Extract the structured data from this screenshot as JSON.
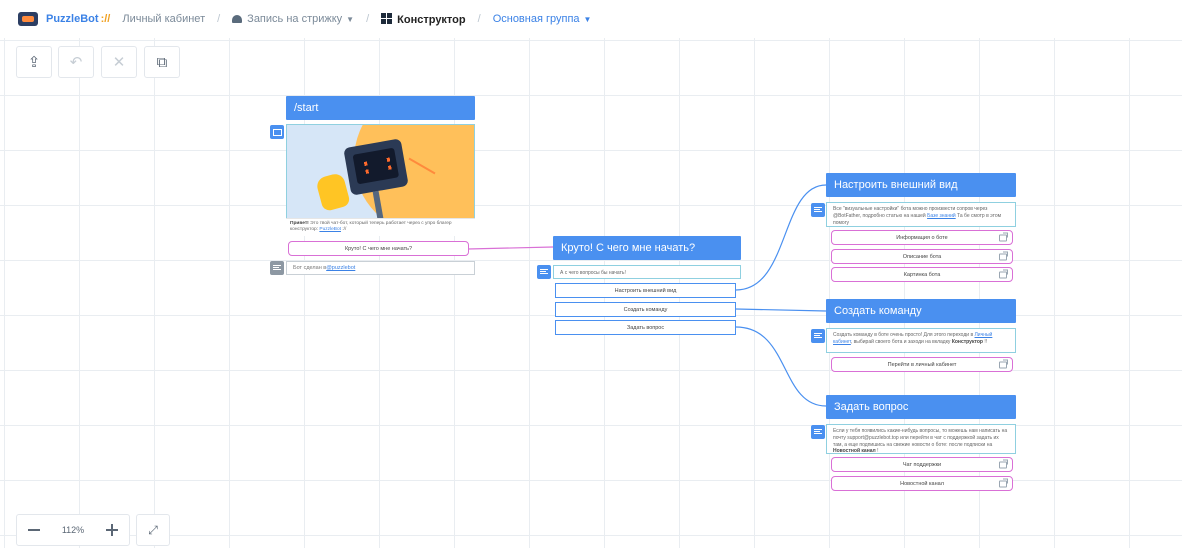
{
  "colors": {
    "accent": "#4a90f0",
    "button_border_pink": "#d970d6",
    "message_border": "#8fd0e0",
    "brand_slash": "#f0a020"
  },
  "breadcrumb": {
    "brand": "PuzzleBot",
    "brand_slash": "://",
    "cabinet": "Личный кабинет",
    "bot": "Запись на стрижку",
    "constructor": "Конструктор",
    "group": "Основная группа"
  },
  "toolbar": {
    "upload_icon": "upload-icon",
    "undo_icon": "undo-icon",
    "delete_icon": "close-icon",
    "add_icon": "add-block-icon"
  },
  "start_node": {
    "title": "/start",
    "image_caption_bold": "Привет!",
    "image_caption": " Это твой чат-бот, который теперь работает через с упро благер конструктор: ",
    "image_caption_link": "PuzzleBot",
    "image_caption_tail": " ://",
    "button": "Круто! С чего мне начать?",
    "note_prefix": "Бот сделан в ",
    "note_link": "@puzzlebot"
  },
  "start_q_node": {
    "title": "Круто! С чего мне начать?",
    "message": "А с чего вопросы бы начать!",
    "buttons": [
      "Настроить внешний вид",
      "Создать команду",
      "Задать вопрос"
    ]
  },
  "appearance_node": {
    "title": "Настроить внешний вид",
    "message_a": "Все \"визуальные настройки\" бота можно произвести сопров через @BotFather, подробно статью на нашей",
    "message_link": "Базе знаний",
    "message_b": " Та бе смотр в этом помогу ",
    "buttons": [
      "Информация о боте",
      "Описание бота",
      "Картинка бота"
    ]
  },
  "command_node": {
    "title": "Создать команду",
    "message_a": "Создать команду в боте очень просто! Для этого переходи в",
    "message_link": "Личный кабинет",
    "message_b": ", выбирай своего бота и заходи на вкладку ",
    "message_bold": "Конструктор",
    "message_c": " !!",
    "buttons": [
      "Перейти в личный кабинет"
    ]
  },
  "question_node": {
    "title": "Задать вопрос",
    "message_a": "Если у тебя появились какие-нибудь вопросы, то можешь нам написать на почту support@puzzlebot.top или перейти в чат с поддержкой задать их там, а еще подпишись на свежие новости о боте: после подписки на ",
    "message_bold": "Новостной канал",
    "message_c": " !",
    "buttons": [
      "Чат поддержки",
      "Новостной канал"
    ]
  },
  "zoom": {
    "level": "112%"
  }
}
